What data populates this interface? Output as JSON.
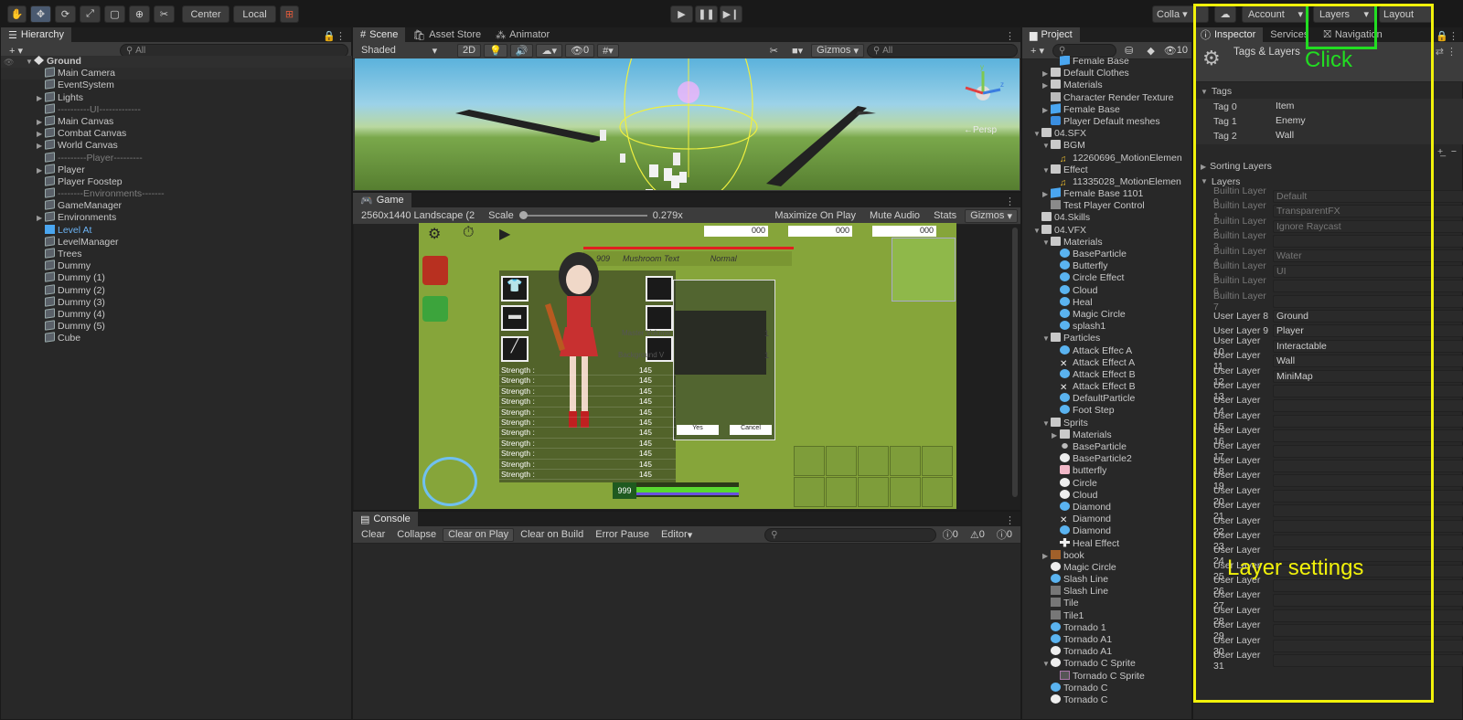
{
  "toolbar": {
    "center_label": "Center",
    "local_label": "Local",
    "collab_label": "Colla",
    "account_label": "Account",
    "layers_label": "Layers",
    "layout_label": "Layout"
  },
  "scene": {
    "tab_scene": "Scene",
    "tab_asset_store": "Asset Store",
    "tab_animator": "Animator",
    "shaded": "Shaded",
    "mode_2d": "2D",
    "gizmos": "Gizmos",
    "search_placeholder": "All",
    "persp": "←Persp",
    "hidden_count": "0"
  },
  "game": {
    "tab": "Game",
    "resolution": "2560x1440 Landscape (2",
    "scale_label": "Scale",
    "scale_value": "0.279x",
    "maximize": "Maximize On Play",
    "mute": "Mute Audio",
    "stats": "Stats",
    "gizmos": "Gizmos",
    "hud_values": [
      "000",
      "000",
      "000"
    ],
    "name_text": "Mushroom Text",
    "level": "909",
    "difficulty": "Normal",
    "stat_rows": [
      {
        "label": "Strength :",
        "value": "145"
      },
      {
        "label": "Strength :",
        "value": "145"
      },
      {
        "label": "Strength :",
        "value": "145"
      },
      {
        "label": "Strength :",
        "value": "145"
      },
      {
        "label": "Strength :",
        "value": "145"
      },
      {
        "label": "Strength :",
        "value": "145"
      },
      {
        "label": "Strength :",
        "value": "145"
      },
      {
        "label": "Strength :",
        "value": "145"
      },
      {
        "label": "Strength :",
        "value": "145"
      },
      {
        "label": "Strength :",
        "value": "145"
      },
      {
        "label": "Strength :",
        "value": "145"
      }
    ],
    "yes": "Yes",
    "cancel": "Cancel",
    "bottom_number": "999",
    "master_volume": "Master Volume",
    "background_volume": "Background V",
    "vol_value": "1"
  },
  "console": {
    "tab": "Console",
    "clear": "Clear",
    "collapse": "Collapse",
    "clear_on_play": "Clear on Play",
    "clear_on_build": "Clear on Build",
    "error_pause": "Error Pause",
    "editor": "Editor",
    "count_info": "0",
    "count_warn": "0",
    "count_err": "0"
  },
  "hierarchy": {
    "tab": "Hierarchy",
    "search_placeholder": "All",
    "items": [
      {
        "label": "Ground",
        "indent": 0,
        "arrow": "▼",
        "icon": "scene",
        "bold": true
      },
      {
        "label": "Main Camera",
        "indent": 1,
        "arrow": "",
        "icon": "cube",
        "selected": true
      },
      {
        "label": "EventSystem",
        "indent": 1,
        "arrow": "",
        "icon": "cube"
      },
      {
        "label": "Lights",
        "indent": 1,
        "arrow": "▶",
        "icon": "cube"
      },
      {
        "label": "----------UI-------------",
        "indent": 1,
        "arrow": "",
        "icon": "cube",
        "sep": true
      },
      {
        "label": "Main Canvas",
        "indent": 1,
        "arrow": "▶",
        "icon": "cube"
      },
      {
        "label": "Combat Canvas",
        "indent": 1,
        "arrow": "▶",
        "icon": "cube"
      },
      {
        "label": "World Canvas",
        "indent": 1,
        "arrow": "▶",
        "icon": "cube"
      },
      {
        "label": "---------Player---------",
        "indent": 1,
        "arrow": "",
        "icon": "cube",
        "sep": true
      },
      {
        "label": "Player",
        "indent": 1,
        "arrow": "▶",
        "icon": "cube"
      },
      {
        "label": "Player Foostep",
        "indent": 1,
        "arrow": "",
        "icon": "cube"
      },
      {
        "label": "--------Environments-------",
        "indent": 1,
        "arrow": "",
        "icon": "cube",
        "sep": true
      },
      {
        "label": "GameManager",
        "indent": 1,
        "arrow": "",
        "icon": "cube"
      },
      {
        "label": "Environments",
        "indent": 1,
        "arrow": "▶",
        "icon": "cube"
      },
      {
        "label": "Level At",
        "indent": 1,
        "arrow": "",
        "icon": "bluecube",
        "blue": true
      },
      {
        "label": "LevelManager",
        "indent": 1,
        "arrow": "",
        "icon": "cube"
      },
      {
        "label": "Trees",
        "indent": 1,
        "arrow": "",
        "icon": "cube"
      },
      {
        "label": "Dummy",
        "indent": 1,
        "arrow": "",
        "icon": "cube"
      },
      {
        "label": "Dummy (1)",
        "indent": 1,
        "arrow": "",
        "icon": "cube"
      },
      {
        "label": "Dummy (2)",
        "indent": 1,
        "arrow": "",
        "icon": "cube"
      },
      {
        "label": "Dummy (3)",
        "indent": 1,
        "arrow": "",
        "icon": "cube"
      },
      {
        "label": "Dummy (4)",
        "indent": 1,
        "arrow": "",
        "icon": "cube"
      },
      {
        "label": "Dummy (5)",
        "indent": 1,
        "arrow": "",
        "icon": "cube"
      },
      {
        "label": "Cube",
        "indent": 1,
        "arrow": "",
        "icon": "cube"
      }
    ]
  },
  "project": {
    "tab": "Project",
    "count": "10",
    "items": [
      {
        "label": "Female Base",
        "indent": 2,
        "icon": "prefab"
      },
      {
        "label": "Default Clothes",
        "indent": 1,
        "arrow": "▶",
        "icon": "folder"
      },
      {
        "label": "Materials",
        "indent": 1,
        "arrow": "▶",
        "icon": "folder"
      },
      {
        "label": "Character Render Texture",
        "indent": 1,
        "icon": "tex"
      },
      {
        "label": "Female Base",
        "indent": 1,
        "arrow": "▶",
        "icon": "prefab"
      },
      {
        "label": "Player Default meshes",
        "indent": 1,
        "icon": "mesh"
      },
      {
        "label": "04.SFX",
        "indent": 0,
        "arrow": "▼",
        "icon": "folder"
      },
      {
        "label": "BGM",
        "indent": 1,
        "arrow": "▼",
        "icon": "folder"
      },
      {
        "label": "12260696_MotionElemen",
        "indent": 2,
        "icon": "audio"
      },
      {
        "label": "Effect",
        "indent": 1,
        "arrow": "▼",
        "icon": "folder"
      },
      {
        "label": "11335028_MotionElemen",
        "indent": 2,
        "icon": "audio"
      },
      {
        "label": "Female Base 1101",
        "indent": 1,
        "arrow": "▶",
        "icon": "prefab"
      },
      {
        "label": "Test Player Control",
        "indent": 1,
        "icon": "ctrl"
      },
      {
        "label": "04.Skills",
        "indent": 0,
        "icon": "folder"
      },
      {
        "label": "04.VFX",
        "indent": 0,
        "arrow": "▼",
        "icon": "folder"
      },
      {
        "label": "Materials",
        "indent": 1,
        "arrow": "▼",
        "icon": "folder"
      },
      {
        "label": "BaseParticle",
        "indent": 2,
        "icon": "blue"
      },
      {
        "label": "Butterfly",
        "indent": 2,
        "icon": "blue"
      },
      {
        "label": "Circle Effect",
        "indent": 2,
        "icon": "blue"
      },
      {
        "label": "Cloud",
        "indent": 2,
        "icon": "blue"
      },
      {
        "label": "Heal",
        "indent": 2,
        "icon": "blue"
      },
      {
        "label": "Magic Circle",
        "indent": 2,
        "icon": "blue"
      },
      {
        "label": "splash1",
        "indent": 2,
        "icon": "blue"
      },
      {
        "label": "Particles",
        "indent": 1,
        "arrow": "▼",
        "icon": "folder"
      },
      {
        "label": "Attack Effec A",
        "indent": 2,
        "icon": "blue"
      },
      {
        "label": "Attack Effect A",
        "indent": 2,
        "icon": "x"
      },
      {
        "label": "Attack Effect B",
        "indent": 2,
        "icon": "blue"
      },
      {
        "label": "Attack Effect B",
        "indent": 2,
        "icon": "x"
      },
      {
        "label": "DefaultParticle",
        "indent": 2,
        "icon": "blue"
      },
      {
        "label": "Foot Step",
        "indent": 2,
        "icon": "blue"
      },
      {
        "label": "Sprits",
        "indent": 1,
        "arrow": "▼",
        "icon": "folder"
      },
      {
        "label": "Materials",
        "indent": 2,
        "arrow": "▶",
        "icon": "folder"
      },
      {
        "label": "BaseParticle",
        "indent": 2,
        "icon": "dot"
      },
      {
        "label": "BaseParticle2",
        "indent": 2,
        "icon": "white"
      },
      {
        "label": "butterfly",
        "indent": 2,
        "icon": "pink"
      },
      {
        "label": "Circle",
        "indent": 2,
        "icon": "white"
      },
      {
        "label": "Cloud",
        "indent": 2,
        "icon": "white"
      },
      {
        "label": "Diamond",
        "indent": 2,
        "icon": "blue"
      },
      {
        "label": "Diamond",
        "indent": 2,
        "icon": "x"
      },
      {
        "label": "Diamond",
        "indent": 2,
        "icon": "blue"
      },
      {
        "label": "Heal Effect",
        "indent": 2,
        "icon": "plus"
      },
      {
        "label": "book",
        "indent": 1,
        "arrow": "▶",
        "icon": "book"
      },
      {
        "label": "Magic Circle",
        "indent": 1,
        "icon": "white"
      },
      {
        "label": "Slash Line",
        "indent": 1,
        "icon": "blue"
      },
      {
        "label": "Slash Line",
        "indent": 1,
        "icon": "gray"
      },
      {
        "label": "Tile",
        "indent": 1,
        "icon": "gray"
      },
      {
        "label": "Tile1",
        "indent": 1,
        "icon": "gray"
      },
      {
        "label": "Tornado 1",
        "indent": 1,
        "icon": "blue"
      },
      {
        "label": "Tornado A1",
        "indent": 1,
        "icon": "blue"
      },
      {
        "label": "Tornado A1",
        "indent": 1,
        "icon": "white"
      },
      {
        "label": "Tornado C Sprite",
        "indent": 1,
        "arrow": "▼",
        "icon": "white"
      },
      {
        "label": "Tornado C Sprite",
        "indent": 2,
        "icon": "sprite"
      },
      {
        "label": "Tornado C",
        "indent": 1,
        "icon": "blue"
      },
      {
        "label": "Tornado C",
        "indent": 1,
        "icon": "white"
      }
    ]
  },
  "inspector": {
    "tab_inspector": "Inspector",
    "tab_services": "Services",
    "tab_navigation": "Navigation",
    "title": "Tags & Layers",
    "tags_header": "Tags",
    "sorting_header": "Sorting Layers",
    "layers_header": "Layers",
    "tags": [
      {
        "label": "Tag 0",
        "value": "Item"
      },
      {
        "label": "Tag 1",
        "value": "Enemy"
      },
      {
        "label": "Tag 2",
        "value": "Wall"
      }
    ],
    "layers": [
      {
        "label": "Builtin Layer 0",
        "value": "Default",
        "dim": true
      },
      {
        "label": "Builtin Layer 1",
        "value": "TransparentFX",
        "dim": true
      },
      {
        "label": "Builtin Layer 2",
        "value": "Ignore Raycast",
        "dim": true
      },
      {
        "label": "Builtin Layer 3",
        "value": "",
        "dim": true
      },
      {
        "label": "Builtin Layer 4",
        "value": "Water",
        "dim": true
      },
      {
        "label": "Builtin Layer 5",
        "value": "UI",
        "dim": true
      },
      {
        "label": "Builtin Layer 6",
        "value": "",
        "dim": true
      },
      {
        "label": "Builtin Layer 7",
        "value": "",
        "dim": true
      },
      {
        "label": "User Layer 8",
        "value": "Ground"
      },
      {
        "label": "User Layer 9",
        "value": "Player"
      },
      {
        "label": "User Layer 10",
        "value": "Interactable"
      },
      {
        "label": "User Layer 11",
        "value": "Wall"
      },
      {
        "label": "User Layer 12",
        "value": "MiniMap"
      },
      {
        "label": "User Layer 13",
        "value": ""
      },
      {
        "label": "User Layer 14",
        "value": ""
      },
      {
        "label": "User Layer 15",
        "value": ""
      },
      {
        "label": "User Layer 16",
        "value": ""
      },
      {
        "label": "User Layer 17",
        "value": ""
      },
      {
        "label": "User Layer 18",
        "value": ""
      },
      {
        "label": "User Layer 19",
        "value": ""
      },
      {
        "label": "User Layer 20",
        "value": ""
      },
      {
        "label": "User Layer 21",
        "value": ""
      },
      {
        "label": "User Layer 22",
        "value": ""
      },
      {
        "label": "User Layer 23",
        "value": ""
      },
      {
        "label": "User Layer 24",
        "value": ""
      },
      {
        "label": "User Layer 25",
        "value": ""
      },
      {
        "label": "User Layer 26",
        "value": ""
      },
      {
        "label": "User Layer 27",
        "value": ""
      },
      {
        "label": "User Layer 28",
        "value": ""
      },
      {
        "label": "User Layer 29",
        "value": ""
      },
      {
        "label": "User Layer 30",
        "value": ""
      },
      {
        "label": "User Layer 31",
        "value": ""
      }
    ]
  },
  "annotations": {
    "click": "Click",
    "layer_settings": "Layer settings",
    "green": "#22dd22",
    "yellow": "#f2f20a"
  }
}
